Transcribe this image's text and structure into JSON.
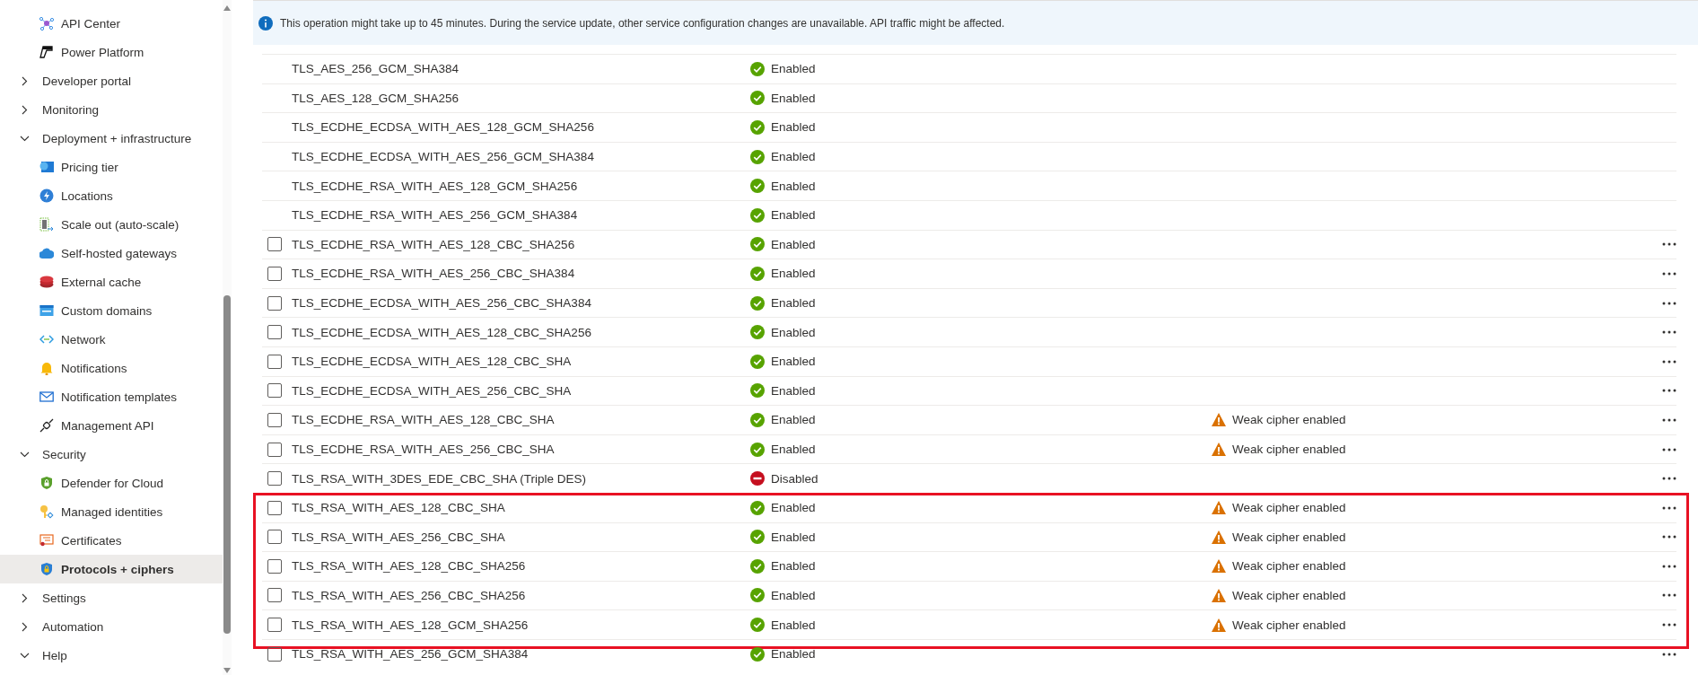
{
  "sidebar": {
    "items": [
      {
        "kind": "link",
        "label": "API Center",
        "selected": false
      },
      {
        "kind": "link",
        "label": "Power Platform",
        "selected": false
      },
      {
        "kind": "group",
        "label": "Developer portal",
        "expanded": false
      },
      {
        "kind": "group",
        "label": "Monitoring",
        "expanded": false
      },
      {
        "kind": "group",
        "label": "Deployment + infrastructure",
        "expanded": true,
        "children": [
          {
            "kind": "link",
            "label": "Pricing tier",
            "selected": false
          },
          {
            "kind": "link",
            "label": "Locations",
            "selected": false
          },
          {
            "kind": "link",
            "label": "Scale out (auto-scale)",
            "selected": false
          },
          {
            "kind": "link",
            "label": "Self-hosted gateways",
            "selected": false
          },
          {
            "kind": "link",
            "label": "External cache",
            "selected": false
          },
          {
            "kind": "link",
            "label": "Custom domains",
            "selected": false
          },
          {
            "kind": "link",
            "label": "Network",
            "selected": false
          },
          {
            "kind": "link",
            "label": "Notifications",
            "selected": false
          },
          {
            "kind": "link",
            "label": "Notification templates",
            "selected": false
          },
          {
            "kind": "link",
            "label": "Management API",
            "selected": false
          }
        ]
      },
      {
        "kind": "group",
        "label": "Security",
        "expanded": true,
        "children": [
          {
            "kind": "link",
            "label": "Defender for Cloud",
            "selected": false
          },
          {
            "kind": "link",
            "label": "Managed identities",
            "selected": false
          },
          {
            "kind": "link",
            "label": "Certificates",
            "selected": false
          },
          {
            "kind": "link",
            "label": "Protocols + ciphers",
            "selected": true
          }
        ]
      },
      {
        "kind": "group",
        "label": "Settings",
        "expanded": false
      },
      {
        "kind": "group",
        "label": "Automation",
        "expanded": false
      },
      {
        "kind": "group",
        "label": "Help",
        "expanded": true
      }
    ]
  },
  "banner": {
    "text": "This operation might take up to 45 minutes. During the service update, other service configuration changes are unavailable. API traffic might be affected."
  },
  "ciphers": {
    "rows": [
      {
        "name": "TLS_AES_256_GCM_SHA384",
        "enabled": true,
        "status_text": "Enabled",
        "highlighted": false
      },
      {
        "name": "TLS_AES_128_GCM_SHA256",
        "enabled": true,
        "status_text": "Enabled",
        "highlighted": false
      },
      {
        "name": "TLS_ECDHE_ECDSA_WITH_AES_128_GCM_SHA256",
        "enabled": true,
        "status_text": "Enabled",
        "highlighted": false
      },
      {
        "name": "TLS_ECDHE_ECDSA_WITH_AES_256_GCM_SHA384",
        "enabled": true,
        "status_text": "Enabled",
        "highlighted": false
      },
      {
        "name": "TLS_ECDHE_RSA_WITH_AES_128_GCM_SHA256",
        "enabled": true,
        "status_text": "Enabled",
        "highlighted": false
      },
      {
        "name": "TLS_ECDHE_RSA_WITH_AES_256_GCM_SHA384",
        "enabled": true,
        "status_text": "Enabled",
        "highlighted": false
      },
      {
        "name": "TLS_ECDHE_RSA_WITH_AES_128_CBC_SHA256",
        "enabled": true,
        "status_text": "Enabled",
        "checked": false,
        "menu": true,
        "highlighted": false
      },
      {
        "name": "TLS_ECDHE_RSA_WITH_AES_256_CBC_SHA384",
        "enabled": true,
        "status_text": "Enabled",
        "checked": false,
        "menu": true,
        "highlighted": false
      },
      {
        "name": "TLS_ECDHE_ECDSA_WITH_AES_256_CBC_SHA384",
        "enabled": true,
        "status_text": "Enabled",
        "checked": false,
        "menu": true,
        "highlighted": false
      },
      {
        "name": "TLS_ECDHE_ECDSA_WITH_AES_128_CBC_SHA256",
        "enabled": true,
        "status_text": "Enabled",
        "checked": false,
        "menu": true,
        "highlighted": false
      },
      {
        "name": "TLS_ECDHE_ECDSA_WITH_AES_128_CBC_SHA",
        "enabled": true,
        "status_text": "Enabled",
        "checked": false,
        "menu": true,
        "highlighted": false
      },
      {
        "name": "TLS_ECDHE_ECDSA_WITH_AES_256_CBC_SHA",
        "enabled": true,
        "status_text": "Enabled",
        "checked": false,
        "menu": true,
        "highlighted": false
      },
      {
        "name": "TLS_ECDHE_RSA_WITH_AES_128_CBC_SHA",
        "enabled": true,
        "status_text": "Enabled",
        "warning": "Weak cipher enabled",
        "checked": false,
        "menu": true,
        "highlighted": false
      },
      {
        "name": "TLS_ECDHE_RSA_WITH_AES_256_CBC_SHA",
        "enabled": true,
        "status_text": "Enabled",
        "warning": "Weak cipher enabled",
        "checked": false,
        "menu": true,
        "highlighted": false
      },
      {
        "name": "TLS_RSA_WITH_3DES_EDE_CBC_SHA (Triple DES)",
        "enabled": false,
        "status_text": "Disabled",
        "checked": false,
        "menu": true,
        "highlighted": false
      },
      {
        "name": "TLS_RSA_WITH_AES_128_CBC_SHA",
        "enabled": true,
        "status_text": "Enabled",
        "warning": "Weak cipher enabled",
        "checked": false,
        "menu": true,
        "highlighted": true
      },
      {
        "name": "TLS_RSA_WITH_AES_256_CBC_SHA",
        "enabled": true,
        "status_text": "Enabled",
        "warning": "Weak cipher enabled",
        "checked": false,
        "menu": true,
        "highlighted": true
      },
      {
        "name": "TLS_RSA_WITH_AES_128_CBC_SHA256",
        "enabled": true,
        "status_text": "Enabled",
        "warning": "Weak cipher enabled",
        "checked": false,
        "menu": true,
        "highlighted": true
      },
      {
        "name": "TLS_RSA_WITH_AES_256_CBC_SHA256",
        "enabled": true,
        "status_text": "Enabled",
        "warning": "Weak cipher enabled",
        "checked": false,
        "menu": true,
        "highlighted": true
      },
      {
        "name": "TLS_RSA_WITH_AES_128_GCM_SHA256",
        "enabled": true,
        "status_text": "Enabled",
        "warning": "Weak cipher enabled",
        "checked": false,
        "menu": true,
        "highlighted": true
      },
      {
        "name": "TLS_RSA_WITH_AES_256_GCM_SHA384",
        "enabled": true,
        "status_text": "Enabled",
        "checked": false,
        "menu": true,
        "highlighted": false
      }
    ]
  }
}
